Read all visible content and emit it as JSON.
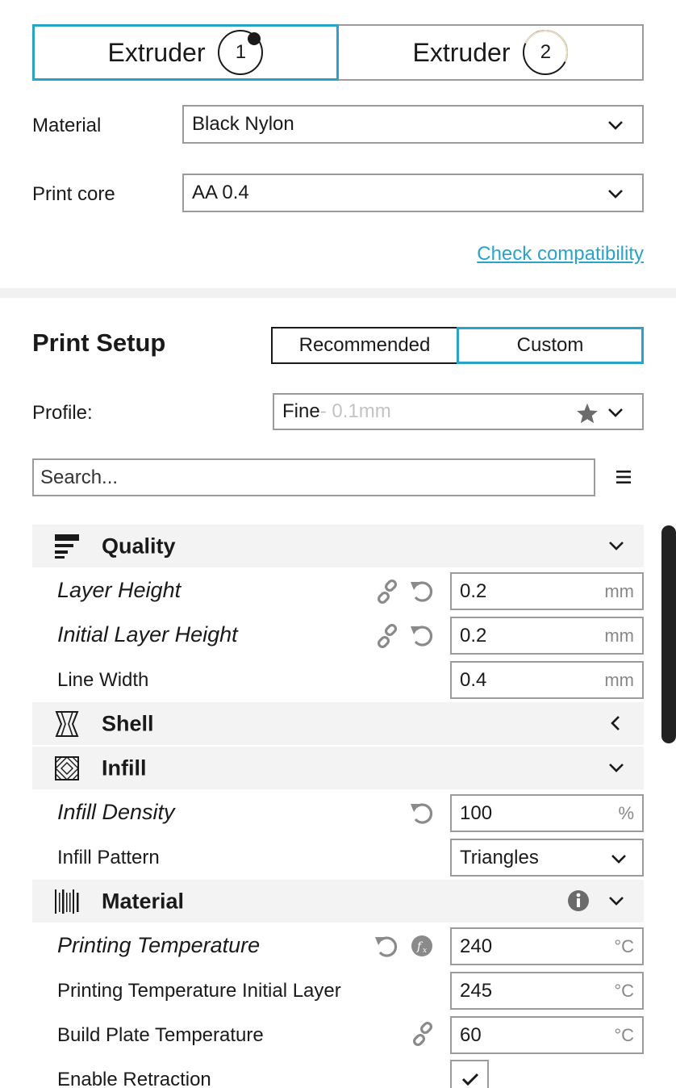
{
  "extruders": {
    "tab1_label": "Extruder",
    "tab1_number": "1",
    "tab2_label": "Extruder",
    "tab2_number": "2"
  },
  "material_row": {
    "label": "Material",
    "value": "Black Nylon"
  },
  "printcore_row": {
    "label": "Print core",
    "value": "AA 0.4"
  },
  "check_compat": "Check compatibility",
  "print_setup": {
    "title": "Print Setup",
    "mode_recommended": "Recommended",
    "mode_custom": "Custom",
    "active_mode": "Custom",
    "profile_label": "Profile:",
    "profile_name": "Fine",
    "profile_suffix": " - 0.1mm"
  },
  "search": {
    "placeholder": "Search..."
  },
  "categories": {
    "quality": "Quality",
    "shell": "Shell",
    "infill": "Infill",
    "material": "Material"
  },
  "settings": {
    "layer_height": {
      "label": "Layer Height",
      "value": "0.2",
      "unit": "mm"
    },
    "initial_layer_height": {
      "label": "Initial Layer Height",
      "value": "0.2",
      "unit": "mm"
    },
    "line_width": {
      "label": "Line Width",
      "value": "0.4",
      "unit": "mm"
    },
    "infill_density": {
      "label": "Infill Density",
      "value": "100",
      "unit": "%"
    },
    "infill_pattern": {
      "label": "Infill Pattern",
      "value": "Triangles"
    },
    "printing_temperature": {
      "label": "Printing Temperature",
      "value": "240",
      "unit": "°C"
    },
    "printing_temperature_initial": {
      "label": "Printing Temperature Initial Layer",
      "value": "245",
      "unit": "°C"
    },
    "build_plate_temperature": {
      "label": "Build Plate Temperature",
      "value": "60",
      "unit": "°C"
    },
    "enable_retraction": {
      "label": "Enable Retraction",
      "checked": true
    }
  },
  "colors": {
    "accent": "#2aa3c8",
    "category_bg": "#f3f3f3",
    "border": "#9b9b9b"
  }
}
